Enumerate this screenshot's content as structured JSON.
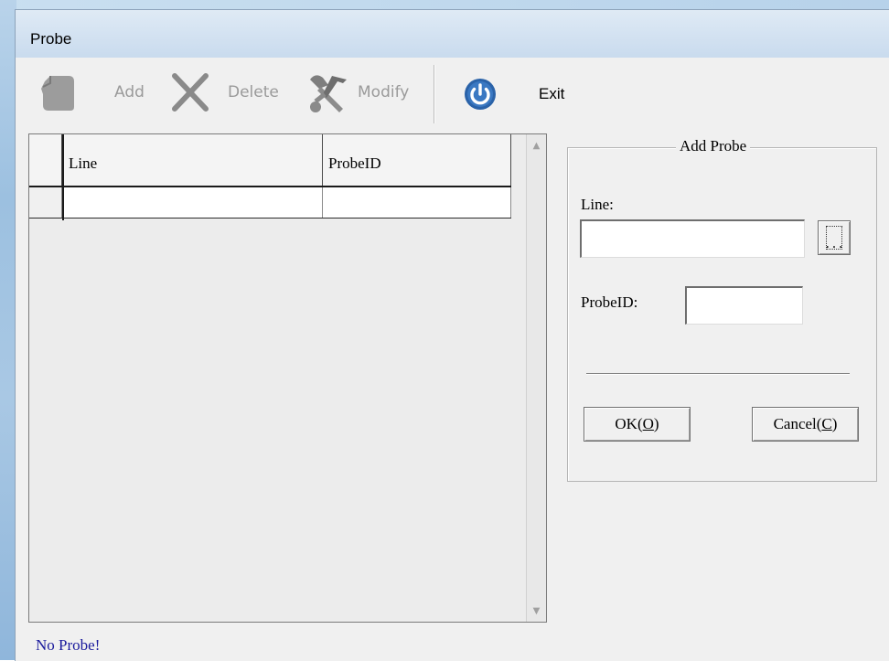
{
  "window": {
    "title": "Probe"
  },
  "toolbar": {
    "add_label": "Add",
    "delete_label": "Delete",
    "modify_label": "Modify",
    "exit_label": "Exit",
    "icons": [
      "add-icon",
      "delete-icon",
      "modify-icon",
      "power-icon"
    ]
  },
  "grid": {
    "columns": [
      "Line",
      "ProbeID"
    ],
    "rows": [
      [
        "",
        ""
      ]
    ]
  },
  "add_probe": {
    "group_title": "Add Probe",
    "line_label": "Line:",
    "line_value": "",
    "browse_label": "...",
    "probeid_label": "ProbeID:",
    "probeid_value": "",
    "ok_label": "OK(",
    "ok_key": "O",
    "ok_close": ")",
    "cancel_label": "Cancel(",
    "cancel_key": "C",
    "cancel_close": ")"
  },
  "status": {
    "message": "No Probe!"
  },
  "colors": {
    "status_text": "#1a1a9c",
    "power_icon_bg": "#2a62a8",
    "title_bar": "#c9dbee"
  }
}
